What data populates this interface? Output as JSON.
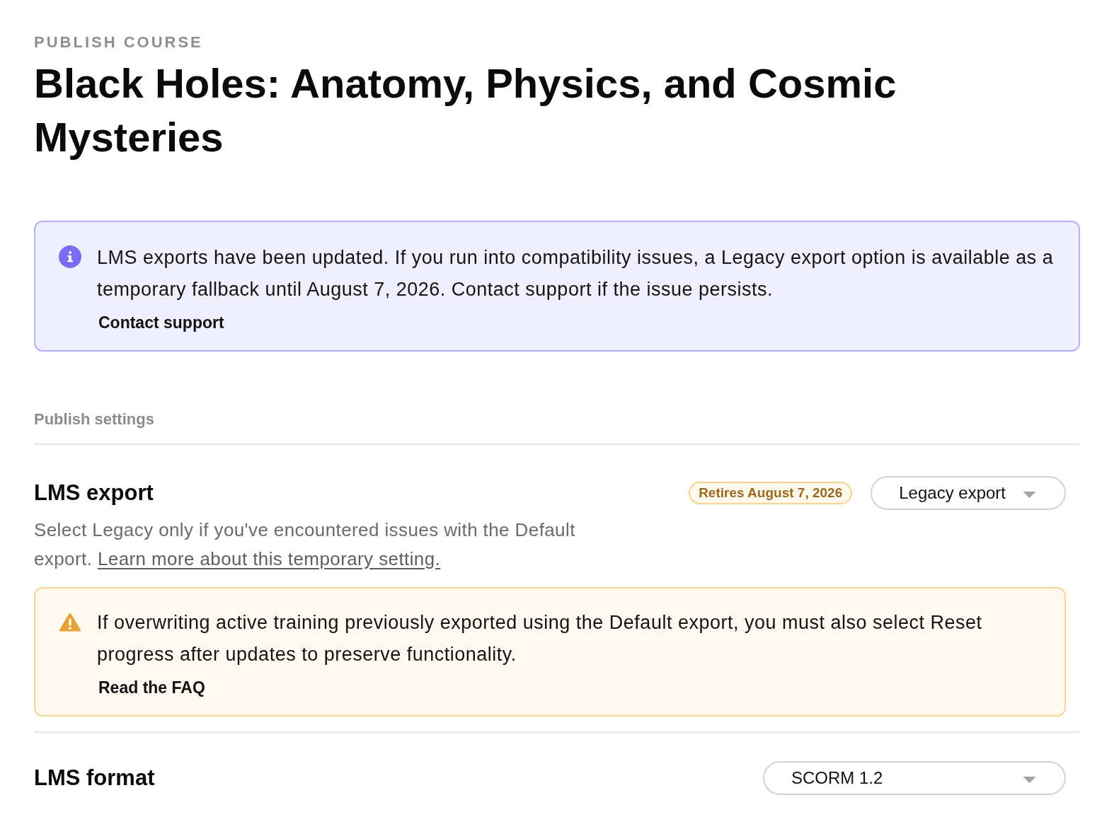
{
  "header": {
    "eyebrow": "PUBLISH COURSE",
    "title": "Black Holes: Anatomy, Physics, and Cosmic Mysteries"
  },
  "notice": {
    "kind": "info",
    "message": "LMS exports have been updated. If you run into compatibility issues, a Legacy export option is available as a temporary fallback until August 7, 2026. Contact support if the issue persists.",
    "link": "Contact support"
  },
  "settings": {
    "heading": "Publish settings",
    "items": [
      {
        "title": "LMS export",
        "badge": "Retires August 7, 2026",
        "select": "Legacy export",
        "description": "Select Legacy only if you've encountered issues with the Default export.",
        "link": "Learn more about this temporary setting.",
        "alert": {
          "kind": "warning",
          "message": "If overwriting active training previously exported using the Default export, you must also select Reset progress after updates to preserve functionality.",
          "link": "Read the FAQ"
        }
      },
      {
        "title": "LMS format",
        "select": "SCORM 1.2"
      }
    ]
  }
}
